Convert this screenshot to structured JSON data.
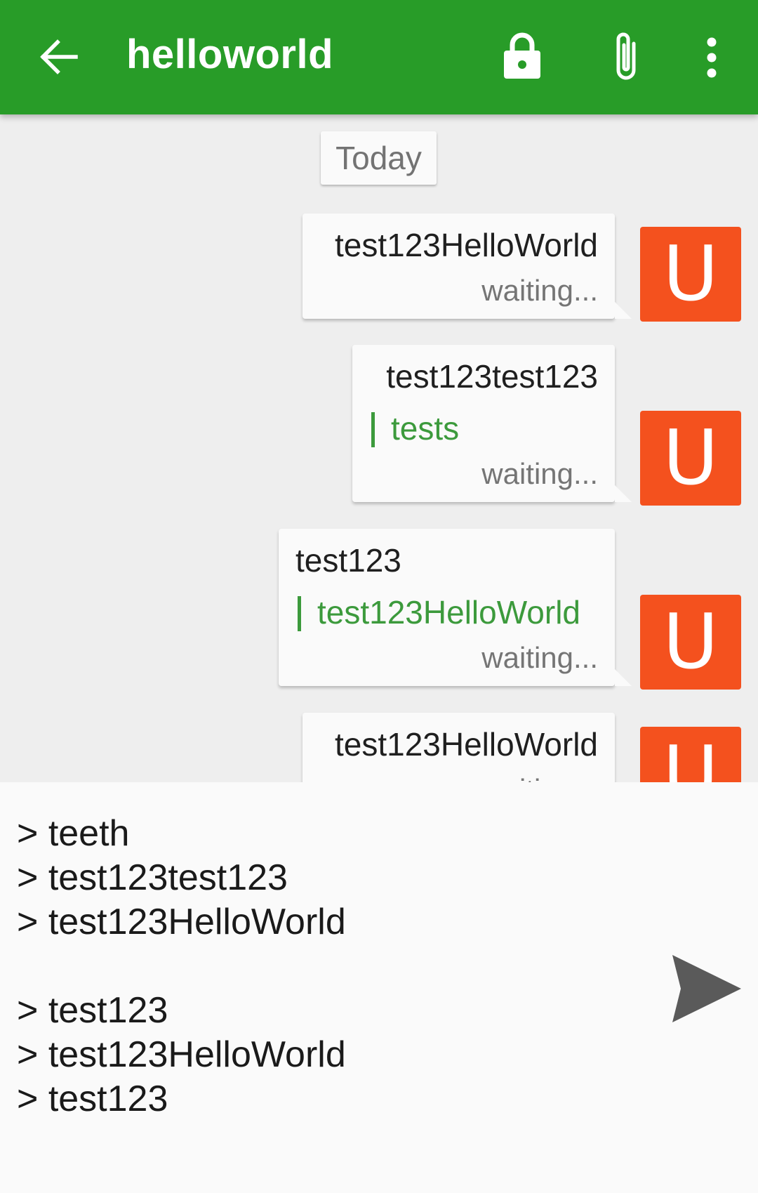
{
  "app_bar": {
    "title": "helloworld",
    "back_icon": "arrow-back-icon",
    "lock_icon": "lock-icon",
    "attach_icon": "paperclip-icon",
    "more_icon": "more-vert-icon",
    "background_color": "#289c28"
  },
  "chat": {
    "date_separator": "Today",
    "messages": [
      {
        "body": "test123HelloWorld",
        "quote": "",
        "status": "waiting...",
        "avatar_letter": "U"
      },
      {
        "body": "test123test123",
        "quote": "tests",
        "status": "waiting...",
        "avatar_letter": "U"
      },
      {
        "body": "test123",
        "quote": "test123HelloWorld",
        "status": "waiting...",
        "avatar_letter": "U"
      },
      {
        "body": "test123HelloWorld",
        "quote": "",
        "status": "waiting...",
        "avatar_letter": "U"
      }
    ],
    "avatar_color": "#f4511e",
    "quote_color": "#3c9a3c"
  },
  "composer": {
    "text": "> teeth\n> test123test123\n> test123HelloWorld\n\n> test123\n> test123HelloWorld\n> test123",
    "send_icon": "send-icon"
  }
}
